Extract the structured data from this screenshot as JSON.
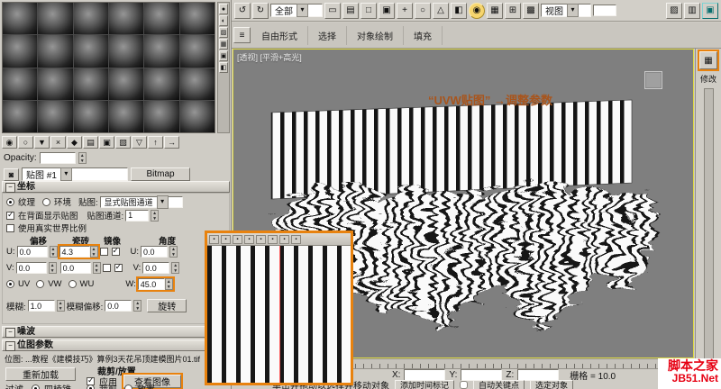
{
  "window": {
    "viewport_label": "[透视] [平滑+高光]",
    "annotation": "“UVW贴图” →调整参数"
  },
  "material_editor": {
    "slot_count": 24,
    "side_buttons": [
      {
        "name": "sample-type-icon",
        "glyph": "●"
      },
      {
        "name": "backlight-icon",
        "glyph": "◐"
      },
      {
        "name": "background-icon",
        "glyph": "▨"
      },
      {
        "name": "sample-uv-tiling-icon",
        "glyph": "▦"
      },
      {
        "name": "video-color-check-icon",
        "glyph": "▣"
      },
      {
        "name": "options-icon",
        "glyph": "◧"
      }
    ],
    "toolbar_buttons": [
      {
        "name": "get-material-icon",
        "glyph": "◉"
      },
      {
        "name": "put-material-icon",
        "glyph": "○"
      },
      {
        "name": "assign-material-icon",
        "glyph": "▼"
      },
      {
        "name": "reset-map-icon",
        "glyph": "×"
      },
      {
        "name": "make-unique-icon",
        "glyph": "◆"
      },
      {
        "name": "put-to-library-icon",
        "glyph": "▤"
      },
      {
        "name": "material-id-icon",
        "glyph": "▣"
      },
      {
        "name": "show-map-in-viewport-icon",
        "glyph": "▧"
      },
      {
        "name": "show-end-result-icon",
        "glyph": "▽"
      },
      {
        "name": "go-to-parent-icon",
        "glyph": "↑"
      },
      {
        "name": "go-forward-icon",
        "glyph": "→"
      }
    ],
    "opacity_label": "Opacity:",
    "opacity_value": "",
    "map_dropdown": "贴图 #1",
    "bitmap_type_button": "Bitmap",
    "coordinates": {
      "title": "坐标",
      "texture_label": "纹理",
      "environment_label": "环境",
      "map_label": "贴图:",
      "map_mode": "显式贴图通道",
      "show_on_back": "在背面显示贴图",
      "map_channel_label": "贴图通道:",
      "map_channel_value": "1",
      "use_real_world": "使用真实世界比例",
      "offset_header": "偏移",
      "tiling_header": "瓷砖",
      "mirror_header": "镜像",
      "angle_header": "角度",
      "u_label": "U:",
      "v_label": "V:",
      "w_label": "W:",
      "u_offset": "0.0",
      "u_tiling": "4.3",
      "u_angle": "0.0",
      "v_offset": "0.0",
      "v_tiling": "0.0",
      "v_angle": "0.0",
      "w_angle": "45.0",
      "uv_label": "UV",
      "vw_label": "VW",
      "wu_label": "WU",
      "blur_label": "模糊:",
      "blur_value": "1.0",
      "blur_offset_label": "模糊偏移:",
      "blur_offset_value": "0.0",
      "rotate_button": "旋转"
    },
    "noise_title": "噪波",
    "bitmap_params_title": "位图参数",
    "bitmap_path": "位图: ...教程《建模技巧》算例3天花吊顶建模图片01.tif",
    "reload_button": "重新加载",
    "crop_place_title": "裁剪/放置",
    "apply_label": "应用",
    "view_image_button": "查看图像",
    "filter_title": "过滤",
    "pyramidal_label": "四棱锥",
    "crop_label": "裁剪",
    "place_label": "放置"
  },
  "top_toolbar": {
    "all_dropdown": "全部",
    "view_dropdown": "视图",
    "left_icons": [
      {
        "name": "undo-icon",
        "glyph": "↺"
      },
      {
        "name": "redo-icon",
        "glyph": "↻"
      }
    ],
    "select_icons": [
      {
        "name": "select-object-icon",
        "glyph": "▭"
      },
      {
        "name": "select-by-name-icon",
        "glyph": "▤"
      },
      {
        "name": "selection-region-icon",
        "glyph": "□"
      },
      {
        "name": "window-crossing-icon",
        "glyph": "▣"
      }
    ],
    "transform_icons": [
      {
        "name": "move-icon",
        "glyph": "+"
      },
      {
        "name": "rotate-icon",
        "glyph": "○"
      },
      {
        "name": "scale-icon",
        "glyph": "△"
      },
      {
        "name": "snap-toggle-icon",
        "glyph": "◧"
      }
    ],
    "highlight_icon": {
      "name": "use-center-icon",
      "glyph": "◉"
    },
    "post_icons": [
      {
        "name": "mirror-icon",
        "glyph": "▦"
      },
      {
        "name": "array-icon",
        "glyph": "⊞"
      },
      {
        "name": "align-icon",
        "glyph": "▩"
      }
    ],
    "tail_icons": [
      {
        "name": "material-editor-icon",
        "glyph": "▨"
      },
      {
        "name": "render-setup-icon",
        "glyph": "▥"
      },
      {
        "name": "render-icon",
        "glyph": "▣",
        "cls": "teal"
      }
    ]
  },
  "ribbon": {
    "left_icons": [
      {
        "name": "ribbon-menu-icon",
        "glyph": "≡"
      }
    ],
    "tabs": [
      {
        "name": "tab-freeform",
        "label": "自由形式"
      },
      {
        "name": "tab-selection",
        "label": "选择"
      },
      {
        "name": "tab-object-paint",
        "label": "对象绘制"
      },
      {
        "name": "tab-populate",
        "label": "填充"
      }
    ]
  },
  "image_viewer": {
    "toolbar_icons": [
      {
        "name": "viewer-save-icon",
        "glyph": "▪"
      },
      {
        "name": "viewer-copy-icon",
        "glyph": "▪"
      },
      {
        "name": "viewer-red-channel-icon",
        "glyph": "▪"
      },
      {
        "name": "viewer-green-channel-icon",
        "glyph": "▪"
      },
      {
        "name": "viewer-blue-channel-icon",
        "glyph": "▪"
      },
      {
        "name": "viewer-alpha-channel-icon",
        "glyph": "▪"
      },
      {
        "name": "viewer-mono-icon",
        "glyph": "▪"
      },
      {
        "name": "viewer-zoom-icon",
        "glyph": "▪"
      }
    ]
  },
  "right_panel": {
    "label": "修改"
  },
  "status_bar": {
    "hint": "单击并拖动以选择并移动对象",
    "x_label": "X:",
    "y_label": "Y:",
    "z_label": "Z:",
    "x_value": "",
    "y_value": "",
    "z_value": "",
    "grid_text": "栅格 = 10.0",
    "add_time_tag": "添加时间标记",
    "auto_key": "自动关键点",
    "selected_btn": "选定对象"
  },
  "watermark": {
    "line1": "脚本之家",
    "line2": "JB51.Net"
  }
}
